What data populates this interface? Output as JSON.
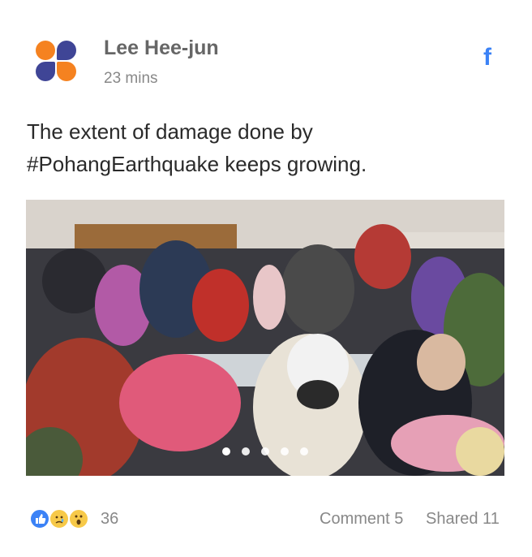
{
  "post": {
    "author": "Lee Hee-jun",
    "time": "23 mins",
    "text": "The extent of damage done by #PohangEarthquake keeps growing.",
    "source_icon": "facebook-icon",
    "photo_count": 5,
    "photo_active_index": 0
  },
  "footer": {
    "reaction_icons": [
      "like-icon",
      "sad-icon",
      "wow-icon"
    ],
    "reaction_count": "36",
    "comment_label": "Comment 5",
    "shared_label": "Shared 11"
  },
  "colors": {
    "accent_orange": "#f58220",
    "accent_navy": "#3f4596",
    "facebook_blue": "#3b82f6"
  }
}
